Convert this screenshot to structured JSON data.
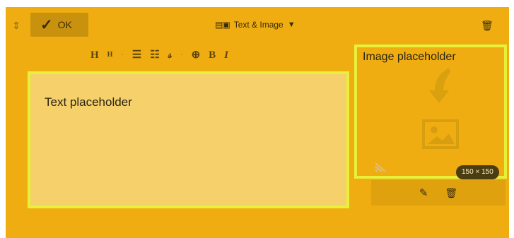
{
  "toolbar": {
    "ok_label": "OK",
    "block_type": "Text & Image",
    "icons": {
      "drag_handle": "move-vertical-icon",
      "confirm": "check-icon",
      "block_type": "text-image-icon",
      "dropdown": "caret-down-icon",
      "delete": "trash-icon"
    }
  },
  "format_bar": {
    "items": [
      {
        "name": "heading-1",
        "label": "H"
      },
      {
        "name": "heading-2",
        "label": "H"
      },
      {
        "name": "separator",
        "label": "·"
      },
      {
        "name": "bulleted-list",
        "label": "☰"
      },
      {
        "name": "numbered-list",
        "label": "☷"
      },
      {
        "name": "link",
        "label": "𝓈"
      },
      {
        "name": "separator-2",
        "label": "·"
      },
      {
        "name": "strikethrough",
        "label": "⊕"
      },
      {
        "name": "bold",
        "label": "B"
      },
      {
        "name": "italic",
        "label": "I"
      }
    ]
  },
  "text_area": {
    "placeholder": "Text placeholder"
  },
  "image_area": {
    "title": "Image placeholder",
    "size_label": "150 × 150",
    "icons": {
      "arrow": "curved-arrow-down-icon",
      "image": "image-icon",
      "resize": "resize-corner-icon"
    }
  },
  "image_actions": {
    "icons": [
      "pencil-icon",
      "trash-icon"
    ]
  },
  "colors": {
    "block_background": "#efad12",
    "highlight_border": "#e8f03a",
    "text_background": "#f6d06b",
    "badge_background": "#4b3d12"
  }
}
